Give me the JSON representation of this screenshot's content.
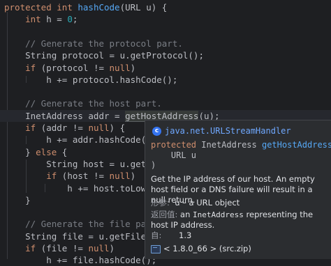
{
  "code": {
    "lines": [
      "protected int hashCode(URL u) {",
      "    int h = 0;",
      "",
      "    // Generate the protocol part.",
      "    String protocol = u.getProtocol();",
      "    if (protocol != null)",
      "        h += protocol.hashCode();",
      "",
      "    // Generate the host part.",
      "    InetAddress addr = getHostAddress(u);",
      "    if (addr != null) {",
      "        h += addr.hashCode();",
      "    } else {",
      "        String host = u.getHost",
      "        if (host != null)",
      "            h += host.toLowerCa",
      "    }",
      "",
      "    // Generate the file part.",
      "    String file = u.getFile();",
      "    if (file != null)",
      "        h += file.hashCode();"
    ],
    "caret_line": 9
  },
  "popup": {
    "class_name": "java.net.URLStreamHandler",
    "signature_line1_mod": "protected",
    "signature_line1_type": "InetAddress",
    "signature_line1_fn": "getHostAddress(",
    "signature_line2": "    URL u",
    "signature_line3": ")",
    "description": "Get the IP address of our host. An empty host field or a DNS failure will result in a null return.",
    "params_label": "形参:",
    "params_value": "u – a URL object",
    "returns_label": "返回值:",
    "returns_value_prefix": "an ",
    "returns_value_code": "InetAddress",
    "returns_value_suffix": " representing the host IP address.",
    "since_label": "自:",
    "since_value": "1.3",
    "footer": "< 1.8.0_66 > (src.zip)",
    "class_icon": "class-c-icon",
    "footer_icon": "library-icon"
  },
  "colors": {
    "background": "#1e1f22",
    "keyword": "#cf8e6d",
    "function": "#56a8f5",
    "number": "#2aacb8",
    "comment": "#7a7e85",
    "popup_bg": "#2b2d30"
  }
}
